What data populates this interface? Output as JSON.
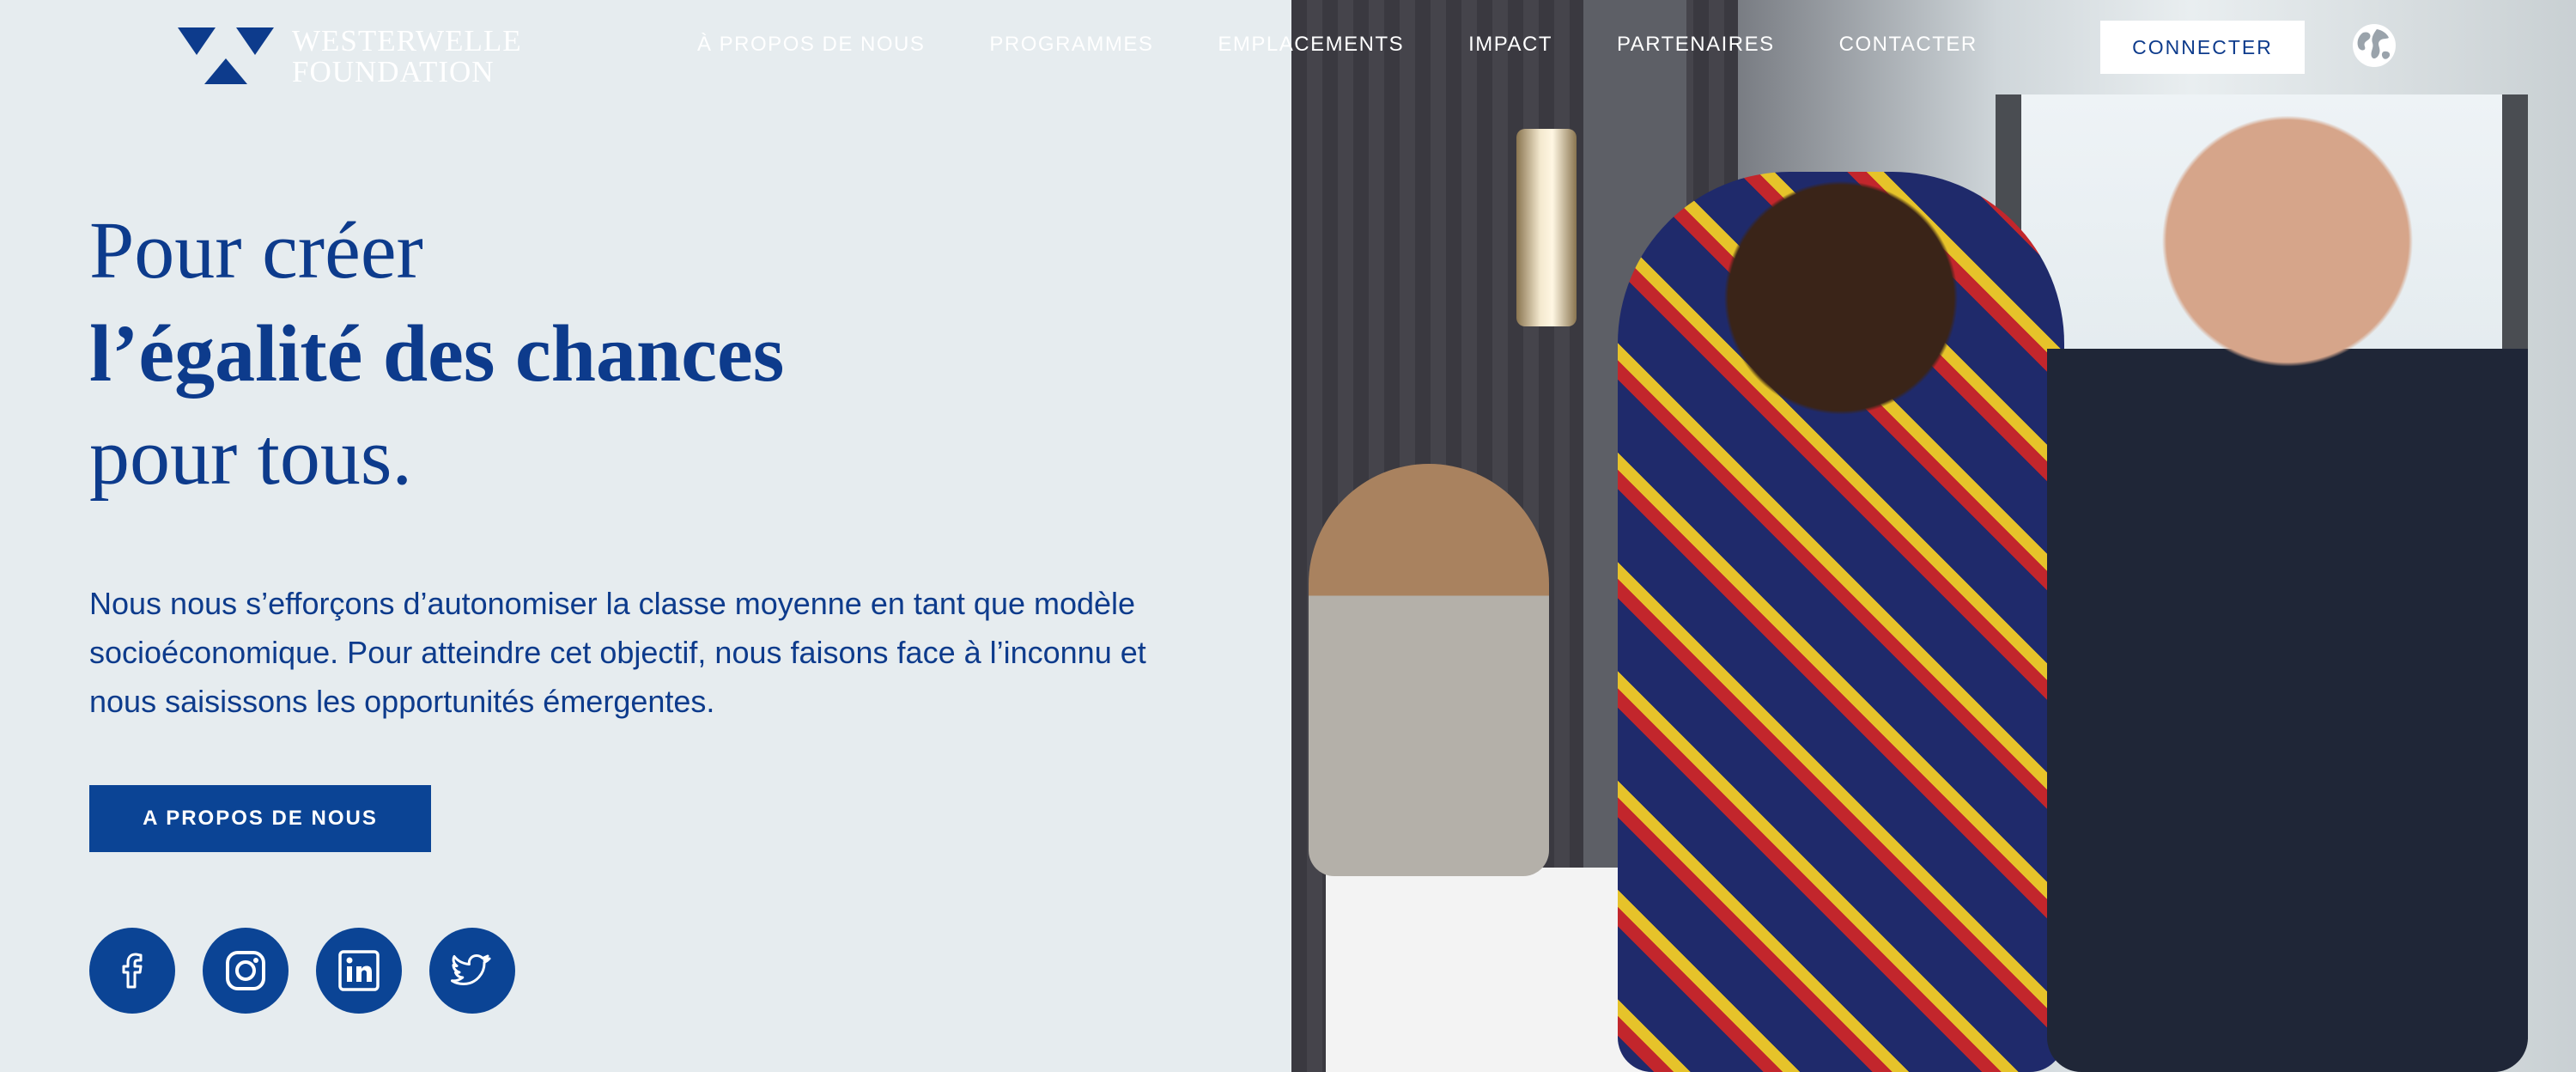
{
  "brand": {
    "line1": "WESTERWELLE",
    "line2": "FOUNDATION",
    "color": "#0d3b8c"
  },
  "nav": {
    "items": [
      "À PROPOS DE NOUS",
      "PROGRAMMES",
      "EMPLACEMENTS",
      "IMPACT",
      "PARTENAIRES",
      "CONTACTER"
    ],
    "connect_label": "CONNECTER",
    "language_icon": "globe-icon"
  },
  "hero": {
    "headline_line1": "Pour créer",
    "headline_line2": "l’égalité des chances",
    "headline_line3": "pour tous.",
    "lead": "Nous nous s’efforçons d’autonomiser la classe moyenne en tant que modèle socioéconomique. Pour atteindre cet objectif, nous faisons face à l’inconnu et nous saisissons les opportunités émergentes.",
    "cta_label": "A PROPOS DE NOUS",
    "accent": "#0b4495",
    "background": "#e6ecef"
  },
  "social": [
    "facebook-icon",
    "instagram-icon",
    "linkedin-icon",
    "twitter-icon"
  ]
}
